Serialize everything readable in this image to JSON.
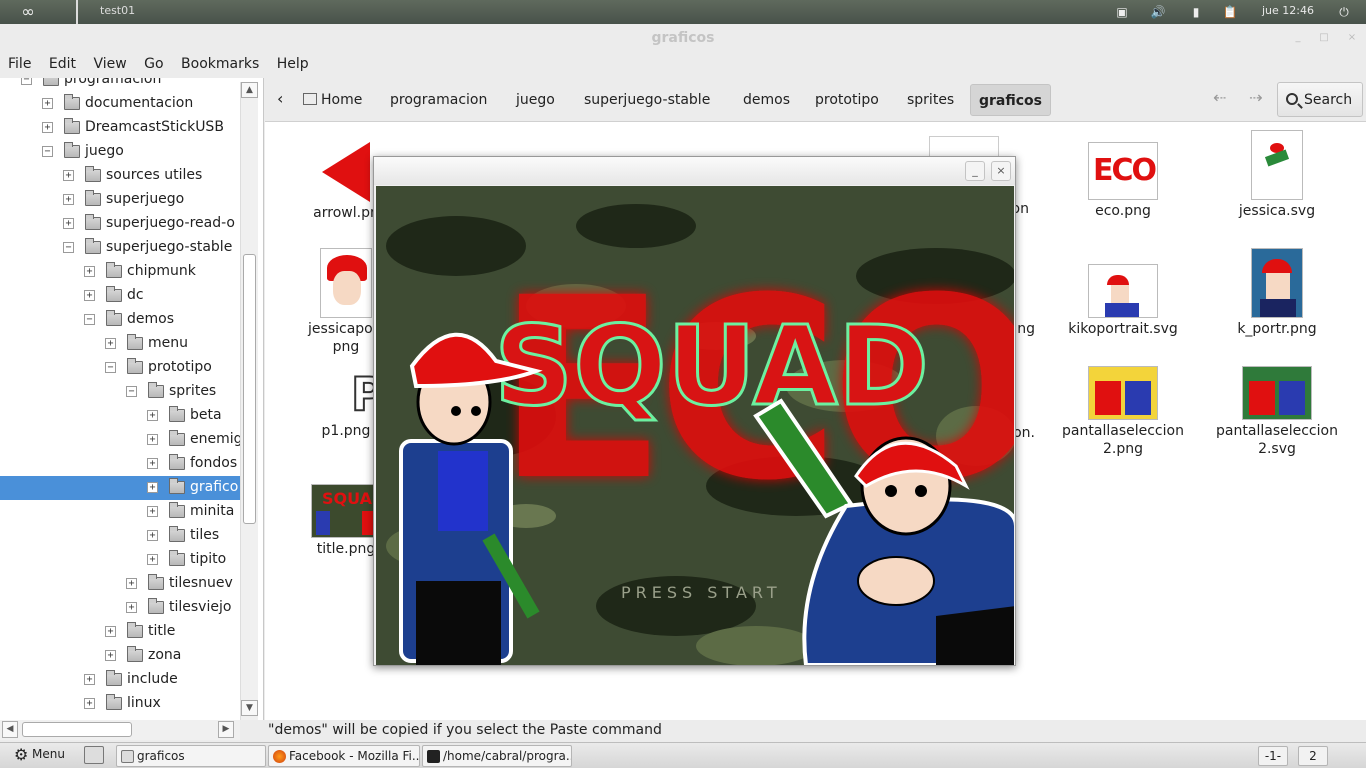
{
  "top_panel": {
    "workspace_label": "test01",
    "clock": "jue 12:46",
    "icons": [
      "infinity-logo-icon",
      "network-icon",
      "volume-icon",
      "battery-icon",
      "clipboard-icon"
    ]
  },
  "window": {
    "title": "graficos",
    "menu": [
      "File",
      "Edit",
      "View",
      "Go",
      "Bookmarks",
      "Help"
    ]
  },
  "sidebar": {
    "items": [
      {
        "label": "programacion",
        "level": 1,
        "expanded": true
      },
      {
        "label": "documentacion",
        "level": 2,
        "expanded": false
      },
      {
        "label": "DreamcastStickUSB",
        "level": 2,
        "expanded": false
      },
      {
        "label": "juego",
        "level": 2,
        "expanded": true
      },
      {
        "label": "sources utiles",
        "level": 3,
        "expanded": false
      },
      {
        "label": "superjuego",
        "level": 3,
        "expanded": false
      },
      {
        "label": "superjuego-read-o",
        "level": 3,
        "expanded": false
      },
      {
        "label": "superjuego-stable",
        "level": 3,
        "expanded": true
      },
      {
        "label": "chipmunk",
        "level": 4,
        "expanded": false
      },
      {
        "label": "dc",
        "level": 4,
        "expanded": false
      },
      {
        "label": "demos",
        "level": 4,
        "expanded": true
      },
      {
        "label": "menu",
        "level": 5,
        "expanded": false
      },
      {
        "label": "prototipo",
        "level": 5,
        "expanded": true
      },
      {
        "label": "sprites",
        "level": 6,
        "expanded": true
      },
      {
        "label": "beta",
        "level": 7,
        "expanded": false
      },
      {
        "label": "enemig",
        "level": 7,
        "expanded": false
      },
      {
        "label": "fondos",
        "level": 7,
        "expanded": false
      },
      {
        "label": "grafico",
        "level": 7,
        "expanded": false,
        "selected": true
      },
      {
        "label": "minita",
        "level": 7,
        "expanded": false
      },
      {
        "label": "tiles",
        "level": 7,
        "expanded": false
      },
      {
        "label": "tipito",
        "level": 7,
        "expanded": false
      },
      {
        "label": "tilesnuev",
        "level": 6,
        "expanded": false
      },
      {
        "label": "tilesviejo",
        "level": 6,
        "expanded": false
      },
      {
        "label": "title",
        "level": 5,
        "expanded": false
      },
      {
        "label": "zona",
        "level": 5,
        "expanded": false
      },
      {
        "label": "include",
        "level": 4,
        "expanded": false
      },
      {
        "label": "linux",
        "level": 4,
        "expanded": false
      }
    ]
  },
  "pathbar": {
    "crumbs": [
      "Home",
      "programacion",
      "juego",
      "superjuego-stable",
      "demos",
      "prototipo",
      "sprites",
      "graficos"
    ],
    "search_label": "Search"
  },
  "files": [
    {
      "name": "arrowl.pn",
      "thumb": "arrow-left"
    },
    {
      "name": "on",
      "thumb": "svg-partial"
    },
    {
      "name": "eco.png",
      "thumb": "eco-logo"
    },
    {
      "name": "jessica.svg",
      "thumb": "jessica"
    },
    {
      "name": "jessicaport\npng",
      "thumb": "jessica-portrait"
    },
    {
      "name": "ng",
      "thumb": "hidden"
    },
    {
      "name": "kikoportrait.svg",
      "thumb": "kiko-portrait"
    },
    {
      "name": "k_portr.png",
      "thumb": "kiko-portrait-blue"
    },
    {
      "name": "p1.png",
      "thumb": "p1"
    },
    {
      "name": "on.",
      "thumb": "hidden"
    },
    {
      "name": "pantallaseleccion\n2.png",
      "thumb": "select-screen-yellow"
    },
    {
      "name": "pantallaseleccion\n2.svg",
      "thumb": "select-screen-green"
    },
    {
      "name": "title.png",
      "thumb": "title-small"
    }
  ],
  "game_window": {
    "logo_back": "ECO",
    "logo_front": "SQUAD",
    "prompt": "PRESS START",
    "minimize": "_",
    "close": "×"
  },
  "statusbar": {
    "message": "\"demos\" will be copied if you select the Paste command"
  },
  "taskbar": {
    "menu_label": "Menu",
    "tasks": [
      "graficos",
      "Facebook - Mozilla Fi...",
      "/home/cabral/progra..."
    ],
    "pager": [
      "-1-",
      "2"
    ]
  },
  "colors": {
    "selection": "#4a90d9",
    "eco_red": "#e01010",
    "squad_green": "#6cf0a0",
    "background": "#ececec"
  }
}
